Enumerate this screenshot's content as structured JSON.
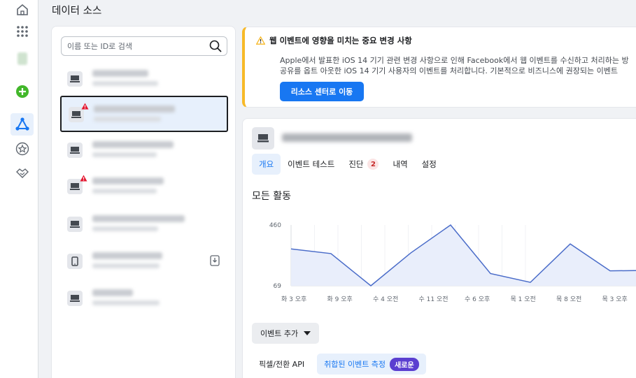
{
  "page_title": "데이터 소스",
  "search": {
    "placeholder": "이름 또는 ID로 검색"
  },
  "alert": {
    "title": "웹 이벤트에 영향을 미치는 중요 변경 사항",
    "body_line1": "Apple에서 발표한 iOS 14 기기 관련 변경 사항으로 인해 Facebook에서 웹 이벤트를 수신하고 처리하는 방",
    "body_line2": "공유를 옵트 아웃한 iOS 14 기기 사용자의 이벤트를 처리합니다. 기본적으로 비즈니스에 권장되는 이벤트",
    "button_label": "리소스 센터로 이동"
  },
  "tabs": [
    {
      "label": "개요",
      "active": true
    },
    {
      "label": "이벤트 테스트"
    },
    {
      "label": "진단",
      "badge": "2"
    },
    {
      "label": "내역"
    },
    {
      "label": "설정"
    }
  ],
  "section_title": "모든 활동",
  "chart_data": {
    "type": "area",
    "title": "모든 활동",
    "x": [
      "화 3 오후",
      "화 9 오후",
      "수 4 오전",
      "수 11 오전",
      "수 6 오후",
      "목 1 오전",
      "목 8 오전",
      "목 3 오후"
    ],
    "values": [
      306,
      276,
      69,
      280,
      460,
      148,
      91,
      338,
      165,
      168
    ],
    "y_ticks": [
      "460",
      "69"
    ],
    "ylim": [
      69,
      460
    ],
    "grid": true
  },
  "add_event_button": "이벤트 추가",
  "bottom_tabs": [
    {
      "label": "픽셀/전환 API",
      "active": false
    },
    {
      "label": "취합된 이벤트 측정",
      "active": true,
      "badge": "새로운"
    }
  ]
}
